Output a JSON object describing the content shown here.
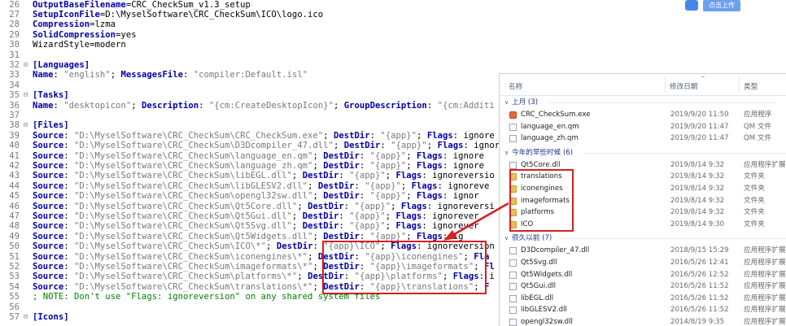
{
  "editor": {
    "lines": [
      {
        "n": "26",
        "parts": [
          {
            "t": "OutputBaseFilename",
            "c": "k"
          },
          {
            "t": "=CRC_CheckSum_v1.3_setup",
            "c": ""
          }
        ]
      },
      {
        "n": "27",
        "parts": [
          {
            "t": "SetupIconFile",
            "c": "k"
          },
          {
            "t": "=D:\\MyselSoftware\\CRC_CheckSum\\ICO\\logo.ico",
            "c": ""
          }
        ]
      },
      {
        "n": "28",
        "parts": [
          {
            "t": "Compression",
            "c": "k"
          },
          {
            "t": "=lzma",
            "c": ""
          }
        ]
      },
      {
        "n": "29",
        "parts": [
          {
            "t": "SolidCompression",
            "c": "k"
          },
          {
            "t": "=yes",
            "c": ""
          }
        ]
      },
      {
        "n": "30",
        "parts": [
          {
            "t": "WizardStyle=modern",
            "c": ""
          }
        ]
      },
      {
        "n": "31",
        "parts": []
      },
      {
        "n": "32",
        "fold": "⊟",
        "parts": [
          {
            "t": "[Languages]",
            "c": "sec"
          }
        ]
      },
      {
        "n": "33",
        "parts": [
          {
            "t": "Name",
            "c": "k"
          },
          {
            "t": ": ",
            "c": ""
          },
          {
            "t": "\"english\"",
            "c": "s"
          },
          {
            "t": "; ",
            "c": ""
          },
          {
            "t": "MessagesFile",
            "c": "k"
          },
          {
            "t": ": ",
            "c": ""
          },
          {
            "t": "\"compiler:Default.isl\"",
            "c": "s"
          }
        ]
      },
      {
        "n": "34",
        "parts": []
      },
      {
        "n": "35",
        "fold": "⊟",
        "parts": [
          {
            "t": "[Tasks]",
            "c": "sec"
          }
        ]
      },
      {
        "n": "36",
        "parts": [
          {
            "t": "Name",
            "c": "k"
          },
          {
            "t": ": ",
            "c": ""
          },
          {
            "t": "\"desktopicon\"",
            "c": "s"
          },
          {
            "t": "; ",
            "c": ""
          },
          {
            "t": "Description",
            "c": "k"
          },
          {
            "t": ": ",
            "c": ""
          },
          {
            "t": "\"{cm:CreateDesktopIcon}\"",
            "c": "s"
          },
          {
            "t": "; ",
            "c": ""
          },
          {
            "t": "GroupDescription",
            "c": "k"
          },
          {
            "t": ": ",
            "c": ""
          },
          {
            "t": "\"{cm:Additi",
            "c": "s"
          }
        ]
      },
      {
        "n": "37",
        "parts": []
      },
      {
        "n": "38",
        "fold": "⊟",
        "parts": [
          {
            "t": "[Files]",
            "c": "sec"
          }
        ]
      },
      {
        "n": "39",
        "parts": [
          {
            "t": "Source",
            "c": "k"
          },
          {
            "t": ": ",
            "c": ""
          },
          {
            "t": "\"D:\\MyselSoftware\\CRC_CheckSum\\CRC_CheckSum.exe\"",
            "c": "s"
          },
          {
            "t": "; ",
            "c": ""
          },
          {
            "t": "DestDir",
            "c": "k"
          },
          {
            "t": ": ",
            "c": ""
          },
          {
            "t": "\"{app}\"",
            "c": "s"
          },
          {
            "t": "; ",
            "c": ""
          },
          {
            "t": "Flags",
            "c": "k"
          },
          {
            "t": ": ignore",
            "c": ""
          }
        ]
      },
      {
        "n": "40",
        "parts": [
          {
            "t": "Source",
            "c": "k"
          },
          {
            "t": ": ",
            "c": ""
          },
          {
            "t": "\"D:\\MyselSoftware\\CRC_CheckSum\\D3Dcompiler_47.dll\"",
            "c": "s"
          },
          {
            "t": "; ",
            "c": ""
          },
          {
            "t": "DestDir",
            "c": "k"
          },
          {
            "t": ": ",
            "c": ""
          },
          {
            "t": "\"{app}\"",
            "c": "s"
          },
          {
            "t": "; ",
            "c": ""
          },
          {
            "t": "Flags",
            "c": "k"
          },
          {
            "t": ": ignor",
            "c": ""
          }
        ]
      },
      {
        "n": "41",
        "parts": [
          {
            "t": "Source",
            "c": "k"
          },
          {
            "t": ": ",
            "c": ""
          },
          {
            "t": "\"D:\\MyselSoftware\\CRC_CheckSum\\language_en.qm\"",
            "c": "s"
          },
          {
            "t": "; ",
            "c": ""
          },
          {
            "t": "DestDir",
            "c": "k"
          },
          {
            "t": ": ",
            "c": ""
          },
          {
            "t": "\"{app}\"",
            "c": "s"
          },
          {
            "t": "; ",
            "c": ""
          },
          {
            "t": "Flags",
            "c": "k"
          },
          {
            "t": ": ignore",
            "c": ""
          }
        ]
      },
      {
        "n": "42",
        "parts": [
          {
            "t": "Source",
            "c": "k"
          },
          {
            "t": ": ",
            "c": ""
          },
          {
            "t": "\"D:\\MyselSoftware\\CRC_CheckSum\\language_zh.qm\"",
            "c": "s"
          },
          {
            "t": "; ",
            "c": ""
          },
          {
            "t": "DestDir",
            "c": "k"
          },
          {
            "t": ": ",
            "c": ""
          },
          {
            "t": "\"{app}\"",
            "c": "s"
          },
          {
            "t": "; ",
            "c": ""
          },
          {
            "t": "Flags",
            "c": "k"
          },
          {
            "t": ": ignore",
            "c": ""
          }
        ]
      },
      {
        "n": "43",
        "parts": [
          {
            "t": "Source",
            "c": "k"
          },
          {
            "t": ": ",
            "c": ""
          },
          {
            "t": "\"D:\\MyselSoftware\\CRC_CheckSum\\libEGL.dll\"",
            "c": "s"
          },
          {
            "t": "; ",
            "c": ""
          },
          {
            "t": "DestDir",
            "c": "k"
          },
          {
            "t": ": ",
            "c": ""
          },
          {
            "t": "\"{app}\"",
            "c": "s"
          },
          {
            "t": "; ",
            "c": ""
          },
          {
            "t": "Flags",
            "c": "k"
          },
          {
            "t": ": ignoreversio",
            "c": ""
          }
        ]
      },
      {
        "n": "44",
        "parts": [
          {
            "t": "Source",
            "c": "k"
          },
          {
            "t": ": ",
            "c": ""
          },
          {
            "t": "\"D:\\MyselSoftware\\CRC_CheckSum\\libGLESV2.dll\"",
            "c": "s"
          },
          {
            "t": "; ",
            "c": ""
          },
          {
            "t": "DestDir",
            "c": "k"
          },
          {
            "t": ": ",
            "c": ""
          },
          {
            "t": "\"{app}\"",
            "c": "s"
          },
          {
            "t": "; ",
            "c": ""
          },
          {
            "t": "Flags",
            "c": "k"
          },
          {
            "t": ": ignoreve",
            "c": ""
          }
        ]
      },
      {
        "n": "45",
        "parts": [
          {
            "t": "Source",
            "c": "k"
          },
          {
            "t": ": ",
            "c": ""
          },
          {
            "t": "\"D:\\MyselSoftware\\CRC_CheckSum\\opengl32sw.dll\"",
            "c": "s"
          },
          {
            "t": "; ",
            "c": ""
          },
          {
            "t": "DestDir",
            "c": "k"
          },
          {
            "t": ": ",
            "c": ""
          },
          {
            "t": "\"{app}\"",
            "c": "s"
          },
          {
            "t": "; ",
            "c": ""
          },
          {
            "t": "Flags",
            "c": "k"
          },
          {
            "t": ": ignor",
            "c": ""
          }
        ]
      },
      {
        "n": "46",
        "parts": [
          {
            "t": "Source",
            "c": "k"
          },
          {
            "t": ": ",
            "c": ""
          },
          {
            "t": "\"D:\\MyselSoftware\\CRC_CheckSum\\Qt5Core.dll\"",
            "c": "s"
          },
          {
            "t": "; ",
            "c": ""
          },
          {
            "t": "DestDir",
            "c": "k"
          },
          {
            "t": ": ",
            "c": ""
          },
          {
            "t": "\"{app}\"",
            "c": "s"
          },
          {
            "t": "; ",
            "c": ""
          },
          {
            "t": "Flags",
            "c": "k"
          },
          {
            "t": ": ignoreversi",
            "c": ""
          }
        ]
      },
      {
        "n": "47",
        "parts": [
          {
            "t": "Source",
            "c": "k"
          },
          {
            "t": ": ",
            "c": ""
          },
          {
            "t": "\"D:\\MyselSoftware\\CRC_CheckSum\\Qt5Gui.dll\"",
            "c": "s"
          },
          {
            "t": "; ",
            "c": ""
          },
          {
            "t": "DestDir",
            "c": "k"
          },
          {
            "t": ": ",
            "c": ""
          },
          {
            "t": "\"{app}\"",
            "c": "s"
          },
          {
            "t": "; ",
            "c": ""
          },
          {
            "t": "Flags",
            "c": "k"
          },
          {
            "t": ": ignorever",
            "c": ""
          }
        ]
      },
      {
        "n": "48",
        "parts": [
          {
            "t": "Source",
            "c": "k"
          },
          {
            "t": ": ",
            "c": ""
          },
          {
            "t": "\"D:\\MyselSoftware\\CRC_CheckSum\\Qt5Svg.dll\"",
            "c": "s"
          },
          {
            "t": "; ",
            "c": ""
          },
          {
            "t": "DestDir",
            "c": "k"
          },
          {
            "t": ": ",
            "c": ""
          },
          {
            "t": "\"{app}\"",
            "c": "s"
          },
          {
            "t": "; ",
            "c": ""
          },
          {
            "t": "Flags",
            "c": "k"
          },
          {
            "t": ": ignorever",
            "c": ""
          }
        ]
      },
      {
        "n": "49",
        "parts": [
          {
            "t": "Source",
            "c": "k"
          },
          {
            "t": ": ",
            "c": ""
          },
          {
            "t": "\"D:\\MyselSoftware\\CRC_CheckSum\\Qt5Widgets.dll\"",
            "c": "s"
          },
          {
            "t": "; ",
            "c": ""
          },
          {
            "t": "DestDir",
            "c": "k"
          },
          {
            "t": ": ",
            "c": ""
          },
          {
            "t": "\"{app}\"",
            "c": "s"
          },
          {
            "t": "; ",
            "c": ""
          },
          {
            "t": "Flags",
            "c": "k"
          },
          {
            "t": ": ig",
            "c": ""
          }
        ]
      },
      {
        "n": "50",
        "parts": [
          {
            "t": "Source",
            "c": "k"
          },
          {
            "t": ": ",
            "c": ""
          },
          {
            "t": "\"D:\\MyselSoftware\\CRC_CheckSum\\ICO\\*\"",
            "c": "s"
          },
          {
            "t": "; ",
            "c": ""
          },
          {
            "t": "DestDir",
            "c": "k"
          },
          {
            "t": ": ",
            "c": ""
          },
          {
            "t": "\"{app}\\ICO\"",
            "c": "s"
          },
          {
            "t": "; ",
            "c": ""
          },
          {
            "t": "Flags",
            "c": "k"
          },
          {
            "t": ": ignoreversion",
            "c": ""
          }
        ]
      },
      {
        "n": "51",
        "parts": [
          {
            "t": "Source",
            "c": "k"
          },
          {
            "t": ": ",
            "c": ""
          },
          {
            "t": "\"D:\\MyselSoftware\\CRC_CheckSum\\iconengines\\*\"",
            "c": "s"
          },
          {
            "t": "; ",
            "c": ""
          },
          {
            "t": "DestDir",
            "c": "k"
          },
          {
            "t": ": ",
            "c": ""
          },
          {
            "t": "\"{app}\\iconengines\"",
            "c": "s"
          },
          {
            "t": "; ",
            "c": ""
          },
          {
            "t": "Fla",
            "c": "k"
          }
        ]
      },
      {
        "n": "52",
        "parts": [
          {
            "t": "Source",
            "c": "k"
          },
          {
            "t": ": ",
            "c": ""
          },
          {
            "t": "\"D:\\MyselSoftware\\CRC_CheckSum\\imageformats\\*\"",
            "c": "s"
          },
          {
            "t": "; ",
            "c": ""
          },
          {
            "t": "DestDir",
            "c": "k"
          },
          {
            "t": ": ",
            "c": ""
          },
          {
            "t": "\"{app}\\imageformats\"",
            "c": "s"
          },
          {
            "t": "; ",
            "c": ""
          },
          {
            "t": "Fl",
            "c": "k"
          }
        ]
      },
      {
        "n": "53",
        "parts": [
          {
            "t": "Source",
            "c": "k"
          },
          {
            "t": ": ",
            "c": ""
          },
          {
            "t": "\"D:\\MyselSoftware\\CRC_CheckSum\\platforms\\*\"",
            "c": "s"
          },
          {
            "t": "; ",
            "c": ""
          },
          {
            "t": "DestDir",
            "c": "k"
          },
          {
            "t": ": ",
            "c": ""
          },
          {
            "t": "\"{app}\\platforms\"",
            "c": "s"
          },
          {
            "t": "; ",
            "c": ""
          },
          {
            "t": "Flags",
            "c": "k"
          },
          {
            "t": ": i",
            "c": ""
          }
        ]
      },
      {
        "n": "54",
        "parts": [
          {
            "t": "Source",
            "c": "k"
          },
          {
            "t": ": ",
            "c": ""
          },
          {
            "t": "\"D:\\MyselSoftware\\CRC_CheckSum\\translations\\*\"",
            "c": "s"
          },
          {
            "t": "; ",
            "c": ""
          },
          {
            "t": "DestDir",
            "c": "k"
          },
          {
            "t": ": ",
            "c": ""
          },
          {
            "t": "\"{app}\\translations\"",
            "c": "s"
          },
          {
            "t": "; ",
            "c": ""
          },
          {
            "t": "F",
            "c": "k"
          }
        ]
      },
      {
        "n": "55",
        "parts": [
          {
            "t": "; NOTE: Don't use \"Flags: ignoreversion\" on any shared system files",
            "c": "c"
          }
        ]
      },
      {
        "n": "56",
        "parts": []
      },
      {
        "n": "57",
        "fold": "⊟",
        "parts": [
          {
            "t": "[Icons]",
            "c": "sec"
          }
        ]
      }
    ]
  },
  "upload_button": "点击上传",
  "explorer": {
    "columns": {
      "name": "名称",
      "date": "修改日期",
      "type": "类型"
    },
    "groups": [
      {
        "label": "上月 (3)",
        "items": [
          {
            "name": "CRC_CheckSum.exe",
            "date": "2019/9/20 11:50",
            "type": "应用程序",
            "icon": "exe-icon"
          },
          {
            "name": "language_en.qm",
            "date": "2019/9/20 11:47",
            "type": "QM 文件",
            "icon": "file-icon"
          },
          {
            "name": "language_zh.qm",
            "date": "2019/9/20 11:47",
            "type": "QM 文件",
            "icon": "file-icon"
          }
        ]
      },
      {
        "label": "今年的早些时候 (6)",
        "items": [
          {
            "name": "Qt5Core.dll",
            "date": "2019/8/14 9:32",
            "type": "应用程序扩展",
            "icon": "file-icon"
          },
          {
            "name": "translations",
            "date": "2019/8/14 9:32",
            "type": "文件夹",
            "icon": "folder-icon"
          },
          {
            "name": "iconengines",
            "date": "2019/8/14 9:32",
            "type": "文件夹",
            "icon": "folder-icon"
          },
          {
            "name": "imageformats",
            "date": "2019/8/14 9:32",
            "type": "文件夹",
            "icon": "folder-icon"
          },
          {
            "name": "platforms",
            "date": "2019/8/14 9:32",
            "type": "文件夹",
            "icon": "folder-icon"
          },
          {
            "name": "ICO",
            "date": "2019/8/14 9:30",
            "type": "文件夹",
            "icon": "folder-icon"
          }
        ]
      },
      {
        "label": "很久以前 (7)",
        "items": [
          {
            "name": "D3Dcompiler_47.dll",
            "date": "2018/9/15 15:29",
            "type": "应用程序扩展",
            "icon": "file-icon"
          },
          {
            "name": "Qt5Svg.dll",
            "date": "2016/5/26 12:41",
            "type": "应用程序扩展",
            "icon": "file-icon"
          },
          {
            "name": "Qt5Widgets.dll",
            "date": "2016/5/26 12:52",
            "type": "应用程序扩展",
            "icon": "file-icon"
          },
          {
            "name": "Qt5Gui.dll",
            "date": "2016/5/26 11:52",
            "type": "应用程序扩展",
            "icon": "file-icon"
          },
          {
            "name": "libEGL.dll",
            "date": "2016/5/26 11:52",
            "type": "应用程序扩展",
            "icon": "file-icon"
          },
          {
            "name": "libGLESV2.dll",
            "date": "2016/5/26 11:52",
            "type": "应用程序扩展",
            "icon": "file-icon"
          },
          {
            "name": "opengl32sw.dll",
            "date": "2014/8/19 9:35",
            "type": "应用程序扩展",
            "icon": "file-icon"
          }
        ]
      }
    ]
  },
  "colors": {
    "highlight_box": "#d42020",
    "keyword": "#0000a8",
    "string": "#7a7a7a",
    "comment": "#008000"
  }
}
